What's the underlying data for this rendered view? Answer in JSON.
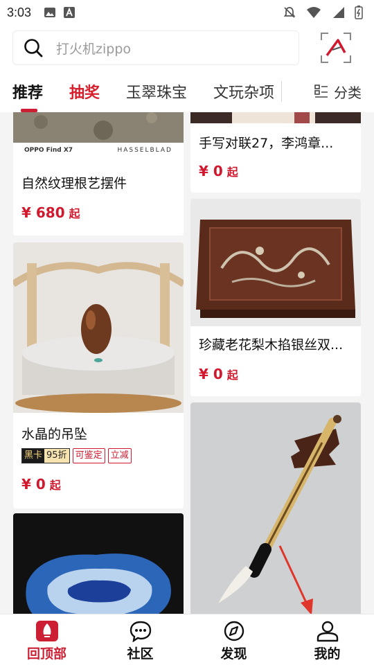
{
  "status_bar": {
    "time": "3:03"
  },
  "search": {
    "placeholder": "打火机zippo"
  },
  "tabs": [
    {
      "label": "推荐"
    },
    {
      "label": "抽奖"
    },
    {
      "label": "玉翠珠宝"
    },
    {
      "label": "文玩杂项"
    }
  ],
  "category": {
    "label": "分类"
  },
  "feed": {
    "left": [
      {
        "title": "自然纹理根艺摆件",
        "price": "¥ 680",
        "unit": "起",
        "photo_brand_left": "OPPO Find X7",
        "photo_brand_right": "HASSELBLAD"
      },
      {
        "title": "水晶的吊坠",
        "price": "¥ 0",
        "unit": "起",
        "tag_black_k": "黑卡",
        "tag_black_d": "95折",
        "tag_1": "可鉴定",
        "tag_2": "立减"
      },
      {
        "title": ""
      }
    ],
    "right": [
      {
        "title": "手写对联27，李鸿章...",
        "price": "¥ 0",
        "unit": "起"
      },
      {
        "title": "珍藏老花梨木掐银丝双...",
        "price": "¥ 0",
        "unit": "起"
      },
      {
        "title": ""
      }
    ]
  },
  "bottom_nav": [
    {
      "label": "回顶部",
      "icon": "back-to-top-icon"
    },
    {
      "label": "社区",
      "icon": "chat-icon"
    },
    {
      "label": "发现",
      "icon": "compass-icon"
    },
    {
      "label": "我的",
      "icon": "profile-icon"
    }
  ],
  "colors": {
    "accent": "#cc1f33",
    "price": "#d0192e",
    "background": "#f4f4f4"
  }
}
